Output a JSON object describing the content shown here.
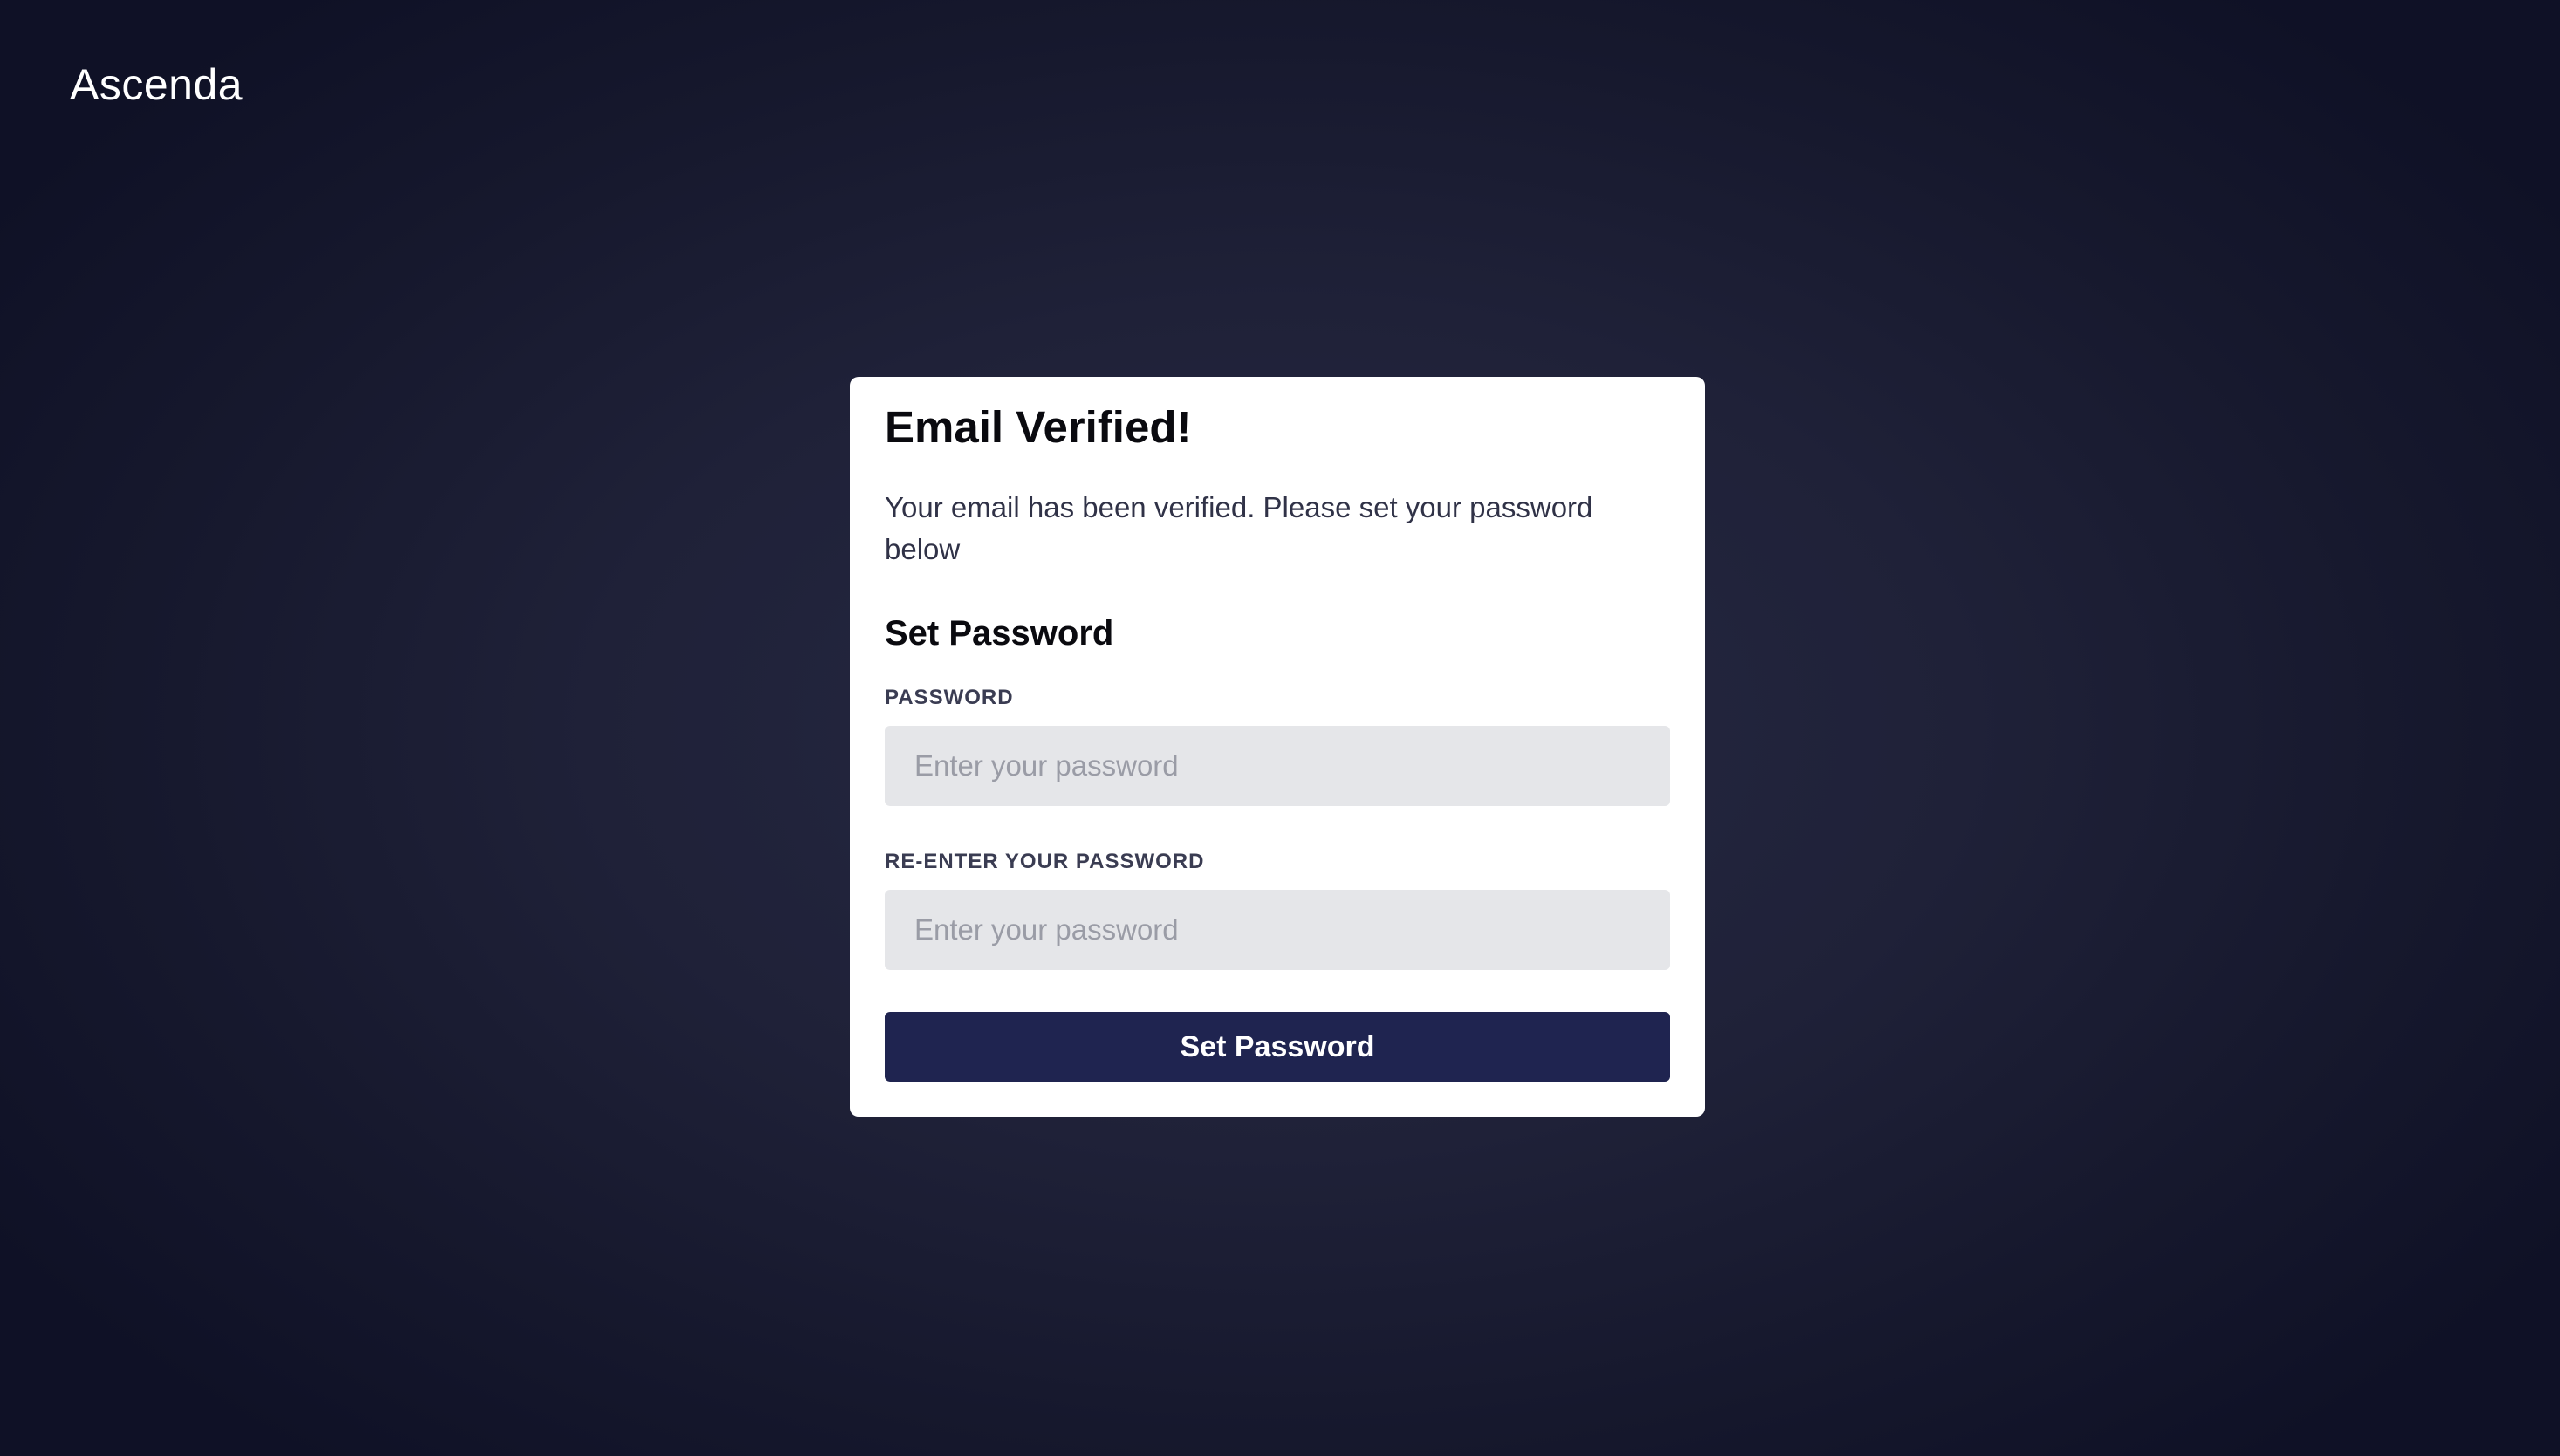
{
  "brand": {
    "logo_text": "Ascenda"
  },
  "card": {
    "title": "Email Verified!",
    "subtitle": "Your email has been verified. Please set your password below",
    "section_title": "Set Password",
    "password_label": "PASSWORD",
    "password_placeholder": "Enter your password",
    "reenter_label": "RE-ENTER YOUR PASSWORD",
    "reenter_placeholder": "Enter your password",
    "submit_label": "Set Password"
  },
  "colors": {
    "background_center": "#262943",
    "background_edge": "#0f1126",
    "button": "#1f2450",
    "input_background": "#e5e6e9"
  }
}
